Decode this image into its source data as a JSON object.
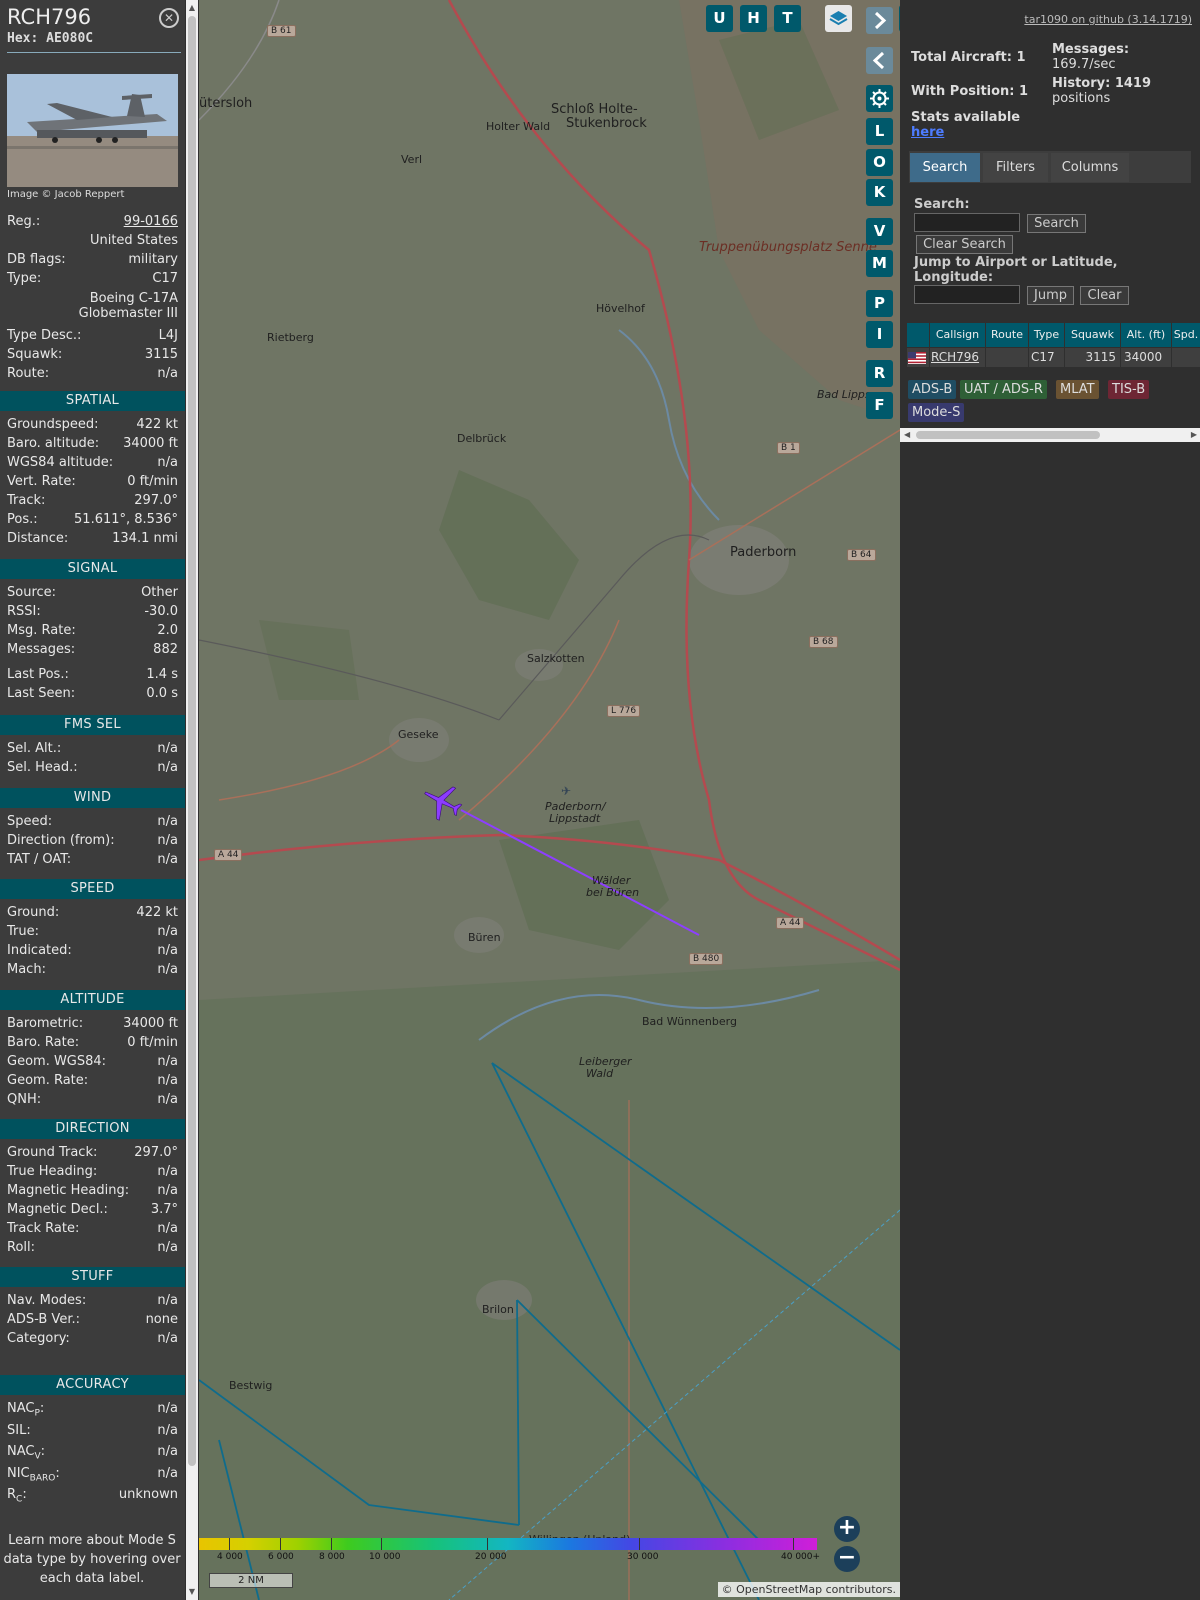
{
  "selected": {
    "callsign": "RCH796",
    "hex": "Hex: AE080C",
    "image_credit": "Image © Jacob Reppert",
    "reg_label": "Reg.:",
    "reg": "99-0166",
    "country": "United States",
    "dbflags_label": "DB flags:",
    "dbflags": "military",
    "type_label": "Type:",
    "type": "C17",
    "type_full": "Boeing C-17A Globemaster III",
    "typedesc_label": "Type Desc.:",
    "typedesc": "L4J",
    "squawk_label": "Squawk:",
    "squawk": "3115",
    "route_label": "Route:",
    "route": "n/a"
  },
  "sections": {
    "spatial": "SPATIAL",
    "signal": "SIGNAL",
    "fms": "FMS SEL",
    "wind": "WIND",
    "speed": "SPEED",
    "altitude": "ALTITUDE",
    "direction": "DIRECTION",
    "stuff": "STUFF",
    "accuracy": "ACCURACY"
  },
  "spatial": [
    {
      "k": "Groundspeed:",
      "v": "422 kt"
    },
    {
      "k": "Baro. altitude:",
      "v": "34000 ft"
    },
    {
      "k": "WGS84 altitude:",
      "v": "n/a"
    },
    {
      "k": "Vert. Rate:",
      "v": "0 ft/min"
    },
    {
      "k": "Track:",
      "v": "297.0°"
    },
    {
      "k": "Pos.:",
      "v": "51.611°, 8.536°"
    },
    {
      "k": "Distance:",
      "v": "134.1 nmi"
    }
  ],
  "signal": [
    {
      "k": "Source:",
      "v": "Other"
    },
    {
      "k": "RSSI:",
      "v": "-30.0"
    },
    {
      "k": "Msg. Rate:",
      "v": "2.0"
    },
    {
      "k": "Messages:",
      "v": "882"
    },
    {
      "k": "Last Pos.:",
      "v": "1.4 s"
    },
    {
      "k": "Last Seen:",
      "v": "0.0 s"
    }
  ],
  "fms": [
    {
      "k": "Sel. Alt.:",
      "v": "n/a"
    },
    {
      "k": "Sel. Head.:",
      "v": "n/a"
    }
  ],
  "wind": [
    {
      "k": "Speed:",
      "v": "n/a"
    },
    {
      "k": "Direction (from):",
      "v": "n/a"
    },
    {
      "k": "TAT / OAT:",
      "v": "n/a"
    }
  ],
  "speed": [
    {
      "k": "Ground:",
      "v": "422 kt"
    },
    {
      "k": "True:",
      "v": "n/a"
    },
    {
      "k": "Indicated:",
      "v": "n/a"
    },
    {
      "k": "Mach:",
      "v": "n/a"
    }
  ],
  "altitude": [
    {
      "k": "Barometric:",
      "v": "34000 ft"
    },
    {
      "k": "Baro. Rate:",
      "v": "0 ft/min"
    },
    {
      "k": "Geom. WGS84:",
      "v": "n/a"
    },
    {
      "k": "Geom. Rate:",
      "v": "n/a"
    },
    {
      "k": "QNH:",
      "v": "n/a"
    }
  ],
  "direction": [
    {
      "k": "Ground Track:",
      "v": "297.0°"
    },
    {
      "k": "True Heading:",
      "v": "n/a"
    },
    {
      "k": "Magnetic Heading:",
      "v": "n/a"
    },
    {
      "k": "Magnetic Decl.:",
      "v": "3.7°"
    },
    {
      "k": "Track Rate:",
      "v": "n/a"
    },
    {
      "k": "Roll:",
      "v": "n/a"
    }
  ],
  "stuff": [
    {
      "k": "Nav. Modes:",
      "v": "n/a"
    },
    {
      "k": "ADS-B Ver.:",
      "v": "none"
    },
    {
      "k": "Category:",
      "v": "n/a"
    }
  ],
  "accuracy": [
    {
      "k": "NAC",
      "sub": "P",
      "v": "n/a"
    },
    {
      "k": "SIL:",
      "sub": "",
      "v": "n/a"
    },
    {
      "k": "NAC",
      "sub": "V",
      "v": "n/a"
    },
    {
      "k": "NIC",
      "sub": "BARO",
      "v": "n/a"
    },
    {
      "k": "R",
      "sub": "C",
      "v": "unknown"
    }
  ],
  "learn_more": "Learn more about Mode S data type by hovering over each data label.",
  "map": {
    "places": [
      {
        "t": "ütersloh",
        "cls": "big"
      },
      {
        "t": "Schloß Holte-",
        "cls": "big"
      },
      {
        "t": "Stukenbrock",
        "cls": "big"
      },
      {
        "t": "Holter Wald",
        "cls": ""
      },
      {
        "t": "Verl",
        "cls": ""
      },
      {
        "t": "Hövelhof",
        "cls": ""
      },
      {
        "t": "Rietberg",
        "cls": ""
      },
      {
        "t": "Delbrück",
        "cls": ""
      },
      {
        "t": "Paderborn",
        "cls": "big"
      },
      {
        "t": "Salzkotten",
        "cls": ""
      },
      {
        "t": "Geseke",
        "cls": ""
      },
      {
        "t": "Büren",
        "cls": ""
      },
      {
        "t": "Bad Wünnenberg",
        "cls": ""
      },
      {
        "t": "Brilon",
        "cls": ""
      },
      {
        "t": "Bestwig",
        "cls": ""
      },
      {
        "t": "Bad Lipps",
        "cls": ""
      },
      {
        "t": "Leiberger",
        "cls": ""
      },
      {
        "t": "Wald",
        "cls": ""
      },
      {
        "t": "Paderborn/",
        "cls": ""
      },
      {
        "t": "Lippstadt",
        "cls": ""
      },
      {
        "t": "Wälder",
        "cls": ""
      },
      {
        "t": "bei Büren",
        "cls": ""
      },
      {
        "t": "Willingen (Upland)",
        "cls": ""
      }
    ],
    "area": "Truppenübungsplatz Senne",
    "shields": [
      "B 61",
      "B 1",
      "B 64",
      "B 68",
      "L 776",
      "A 44",
      "A 44",
      "B 480"
    ],
    "toolbar": [
      "U",
      "H",
      "T"
    ],
    "side_buttons": [
      "L",
      "O",
      "K",
      "V",
      "M",
      "P",
      "I",
      "R",
      "F"
    ],
    "legend_ticks": [
      "4 000",
      "6 000",
      "8 000",
      "10 000",
      "20 000",
      "30 000",
      "40 000+"
    ],
    "scale": "2 NM",
    "attribution": "© OpenStreetMap contributors."
  },
  "sidebar": {
    "github": "tar1090 on github (3.14.1719)",
    "total_aircraft": "Total Aircraft: 1",
    "with_position": "With Position: 1",
    "messages_label": "Messages:",
    "messages": "169.7/sec",
    "history_label": "History: 1419",
    "history_positions": "positions",
    "stats_text": "Stats available",
    "stats_link": "here",
    "tabs": [
      "Search",
      "Filters",
      "Columns"
    ],
    "search_label": "Search:",
    "search_btn": "Search",
    "clear_search": "Clear Search",
    "jump_label": "Jump to Airport or Latitude, Longitude:",
    "jump_btn": "Jump",
    "clear_btn": "Clear",
    "columns": [
      "Callsign",
      "Route",
      "Type",
      "Squawk",
      "Alt. (ft)",
      "Spd."
    ],
    "row": {
      "callsign": "RCH796",
      "route": "",
      "type": "C17",
      "squawk": "3115",
      "alt": "34000",
      "spd": ""
    },
    "badges": [
      {
        "t": "ADS-B",
        "bg": "#1f4d63",
        "fg": "#ddd"
      },
      {
        "t": "UAT / ADS-R",
        "bg": "#2e5f36",
        "fg": "#ddd"
      },
      {
        "t": "MLAT",
        "bg": "#6a5232",
        "fg": "#ddd"
      },
      {
        "t": "TIS-B",
        "bg": "#6e2634",
        "fg": "#ddd"
      },
      {
        "t": "Mode-S",
        "bg": "#383a6e",
        "fg": "#ddd"
      }
    ]
  }
}
